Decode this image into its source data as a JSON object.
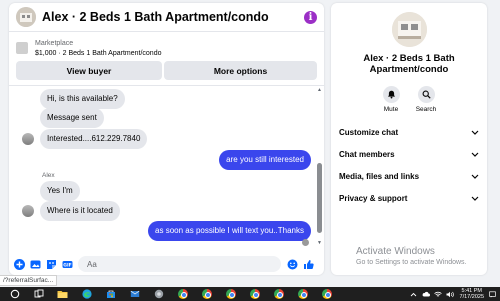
{
  "chat": {
    "title": "Alex · 2 Beds 1 Bath Apartment/condo",
    "info_icon": "info-icon",
    "listing": {
      "marketplace_label": "Marketplace",
      "item_line": "$1,000 · 2 Beds 1 Bath Apartment/condo",
      "view_buyer_label": "View buyer",
      "more_options_label": "More options"
    },
    "messages": [
      {
        "side": "in",
        "text": "Hi, is this available?"
      },
      {
        "side": "in",
        "text": "Message sent"
      },
      {
        "side": "in",
        "text": "Interested....612.229.7840"
      },
      {
        "side": "out",
        "text": "are you still interested"
      },
      {
        "side": "in",
        "text": "Yes I'm",
        "sender": "Alex"
      },
      {
        "side": "in",
        "text": "Where is it located"
      },
      {
        "side": "out",
        "text": "as soon as possible I will text you..Thanks"
      }
    ],
    "composer": {
      "placeholder": "Aa"
    }
  },
  "info_panel": {
    "title": "Alex · 2 Beds 1 Bath Apartment/condo",
    "actions": [
      {
        "label": "Mute",
        "icon": "bell-icon"
      },
      {
        "label": "Search",
        "icon": "search-icon"
      }
    ],
    "sections": [
      "Customize chat",
      "Chat members",
      "Media, files and links",
      "Privacy & support"
    ]
  },
  "watermark": {
    "title": "Activate Windows",
    "subtitle": "Go to Settings to activate Windows."
  },
  "status_url": "/?referralSurfac...",
  "taskbar": {
    "time": "5:41 PM",
    "date": "7/17/2025"
  },
  "colors": {
    "outgoing_bubble": "#3a46ed",
    "incoming_bubble": "#e4e6eb",
    "messenger_blue": "#0866ff",
    "info_purple": "#9b2fc6"
  }
}
